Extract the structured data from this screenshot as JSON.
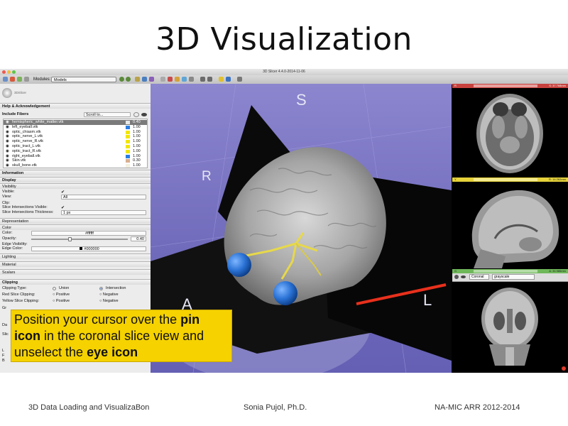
{
  "slide": {
    "title": "3D Visualization",
    "callout": {
      "part1": "Position your cursor over the ",
      "bold1": "pin icon",
      "part2": " in the coronal slice view and unselect the ",
      "bold2": "eye icon"
    },
    "footer": {
      "left": "3D Data Loading and VisualizaBon",
      "center": "Sonia Pujol, Ph.D.",
      "right": "NA-MIC ARR 2012-2014"
    }
  },
  "app": {
    "window_title": "3D Slicer 4.4.0-2014-11-06",
    "toolbar": {
      "modules_label": "Modules:",
      "module_value": "Models"
    },
    "logo_text": "3DSlicer",
    "sections": {
      "help": "Help & Acknowledgement",
      "include_fibers": "Include Fibers",
      "scroll_to": "Scroll to...",
      "information": "Information",
      "display": "Display",
      "visibility": "Visibility",
      "representation": "Representation",
      "color": "Color",
      "lighting": "Lighting",
      "material": "Material",
      "scalars": "Scalars",
      "clipping": "Clipping"
    },
    "models": [
      {
        "name": "hemispheric_white_matter.vtk",
        "opacity": "0.40",
        "color": "#e8e8e8",
        "selected": true
      },
      {
        "name": "left_eyeball.vtk",
        "opacity": "1.00",
        "color": "#2a7de1"
      },
      {
        "name": "optic_chiasm.vtk",
        "opacity": "1.00",
        "color": "#f2e600"
      },
      {
        "name": "optic_nerve_L.vtk",
        "opacity": "1.00",
        "color": "#f2e600"
      },
      {
        "name": "optic_nerve_R.vtk",
        "opacity": "1.00",
        "color": "#f2e600"
      },
      {
        "name": "optic_tract_L.vtk",
        "opacity": "1.00",
        "color": "#f2e600"
      },
      {
        "name": "optic_tract_R.vtk",
        "opacity": "1.00",
        "color": "#f2e600"
      },
      {
        "name": "right_eyeball.vtk",
        "opacity": "1.00",
        "color": "#2a7de1"
      },
      {
        "name": "Skin.vtk",
        "opacity": "0.30",
        "color": "#d8b090"
      },
      {
        "name": "skull_bone.vtk",
        "opacity": "1.00",
        "color": "#f4f0e0"
      }
    ],
    "visibility": {
      "visible_label": "Visible:",
      "view_label": "View:",
      "view_value": "All",
      "clip_label": "Clip:",
      "slice_int_visible_label": "Slice Intersections Visible:",
      "slice_int_thickness_label": "Slice Intersections Thickness:",
      "slice_int_thickness_value": "1 px"
    },
    "color": {
      "color_label": "Color:",
      "color_value": "#ffffff",
      "opacity_label": "Opacity:",
      "opacity_value": "0.40",
      "edge_visibility_label": "Edge Visibility:",
      "edge_color_label": "Edge Color:",
      "edge_color_value": "#000000"
    },
    "clipping": {
      "type_label": "Clipping Type:",
      "union": "Union",
      "intersection": "Intersection",
      "red_label": "Red Slice Clipping:",
      "yellow_label": "Yellow Slice Clipping:",
      "positive": "Positive",
      "negative": "Negative",
      "gr_label": "Gr",
      "da_label": "Da",
      "slic_label": "Slic"
    },
    "view3d": {
      "S": "S",
      "R": "R",
      "A": "A",
      "L": "L"
    },
    "slices": {
      "red": {
        "letter": "R",
        "offset": "S: 37.768mm"
      },
      "yellow": {
        "letter": "Y",
        "offset": "R: 14.262mm"
      },
      "green": {
        "letter": "G",
        "offset": "A: 34.986mm",
        "orientation": "Coronal",
        "volume": "grayscale"
      }
    },
    "left_letters": [
      "L",
      "F",
      "B"
    ],
    "colors": {
      "red_bar": "#c8423e",
      "yellow_bar": "#e6d23a",
      "green_bar": "#6fb85a",
      "callout": "#f5d200",
      "arrow": "#e8301c"
    }
  }
}
